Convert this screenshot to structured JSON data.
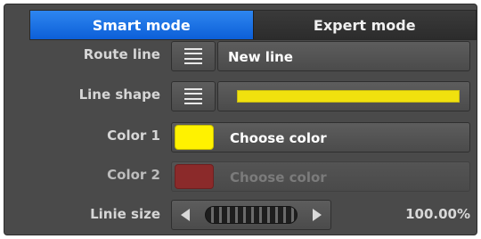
{
  "tabs": [
    {
      "label": "Smart mode",
      "active": true
    },
    {
      "label": "Expert mode",
      "active": false
    }
  ],
  "rows": {
    "route_line": {
      "label": "Route line",
      "value": "New line"
    },
    "line_shape": {
      "label": "Line shape"
    },
    "color1": {
      "label": "Color 1",
      "button": "Choose color",
      "color": "#FFF200"
    },
    "color2": {
      "label": "Color 2",
      "button": "Choose color",
      "color": "#8B2A2A"
    },
    "linie_size": {
      "label": "Linie size",
      "value": "100.00%"
    }
  },
  "icons": {
    "menu": "hamburger-menu-icon",
    "left_arrow": "left-arrow-icon",
    "right_arrow": "right-arrow-icon"
  },
  "colors": {
    "panel_bg": "#4A4A4A",
    "tab_active": "#1E74E6",
    "line_yellow": "#F0E10E"
  }
}
